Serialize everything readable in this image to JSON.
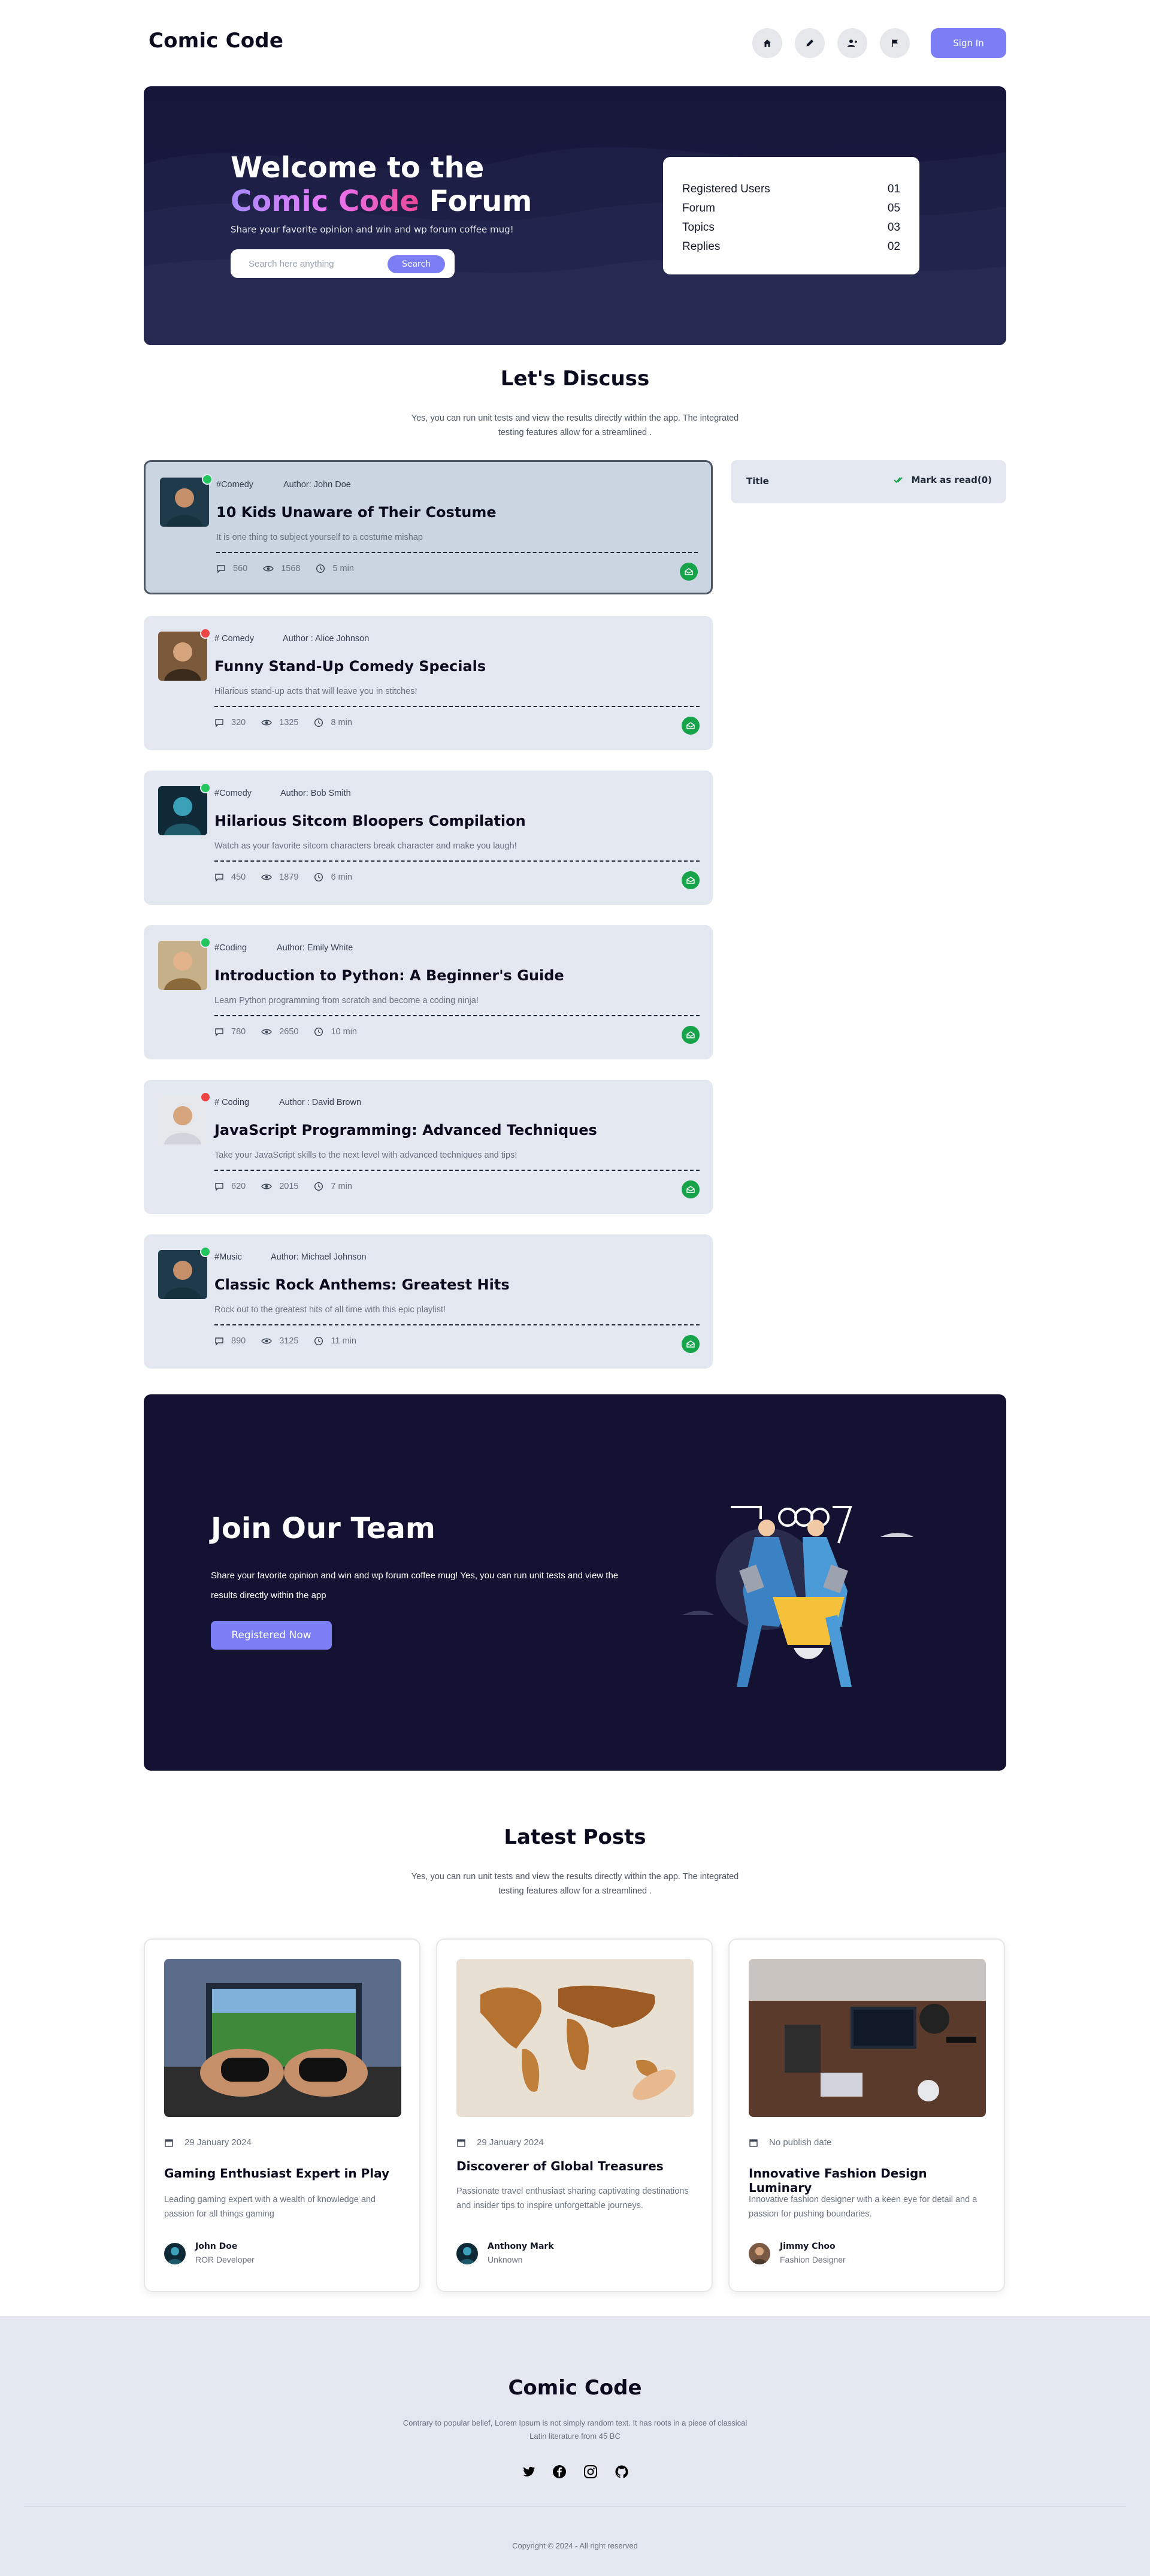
{
  "header": {
    "logo": "Comic Code",
    "icons": [
      "home-icon",
      "pencil-icon",
      "add-user-icon",
      "flag-icon"
    ],
    "signin_label": "Sign In"
  },
  "hero": {
    "title_line1": "Welcome to the",
    "title_highlight": "Comic Code",
    "title_rest": " Forum",
    "subtitle": "Share your favorite opinion and win and wp forum coffee mug!",
    "search_placeholder": "Search here anything",
    "search_button": "Search",
    "stats": [
      {
        "label": "Registered Users",
        "value": "01"
      },
      {
        "label": "Forum",
        "value": "05"
      },
      {
        "label": "Topics",
        "value": "03"
      },
      {
        "label": "Replies",
        "value": "02"
      }
    ]
  },
  "discuss": {
    "title": "Let's Discuss",
    "description": "Yes, you can run unit tests and view the results directly within the app. The integrated testing features allow for a streamlined .",
    "side_title": "Title",
    "mark_read": "Mark as read(0)",
    "topics": [
      {
        "tag": "#Comedy",
        "author": "Author: John Doe",
        "title": "10 Kids Unaware of Their Costume",
        "desc": "It is one thing to subject yourself to a costume mishap",
        "comments": "560",
        "views": "1568",
        "time": "5 min",
        "status_color": "#22c55e"
      },
      {
        "tag": "# Comedy",
        "author": "Author : Alice Johnson",
        "title": "Funny Stand-Up Comedy Specials",
        "desc": "Hilarious stand-up acts that will leave you in stitches!",
        "comments": "320",
        "views": "1325",
        "time": "8 min",
        "status_color": "#ef4444"
      },
      {
        "tag": "#Comedy",
        "author": "Author: Bob Smith",
        "title": "Hilarious Sitcom Bloopers Compilation",
        "desc": "Watch as your favorite sitcom characters break character and make you laugh!",
        "comments": "450",
        "views": "1879",
        "time": "6 min",
        "status_color": "#22c55e"
      },
      {
        "tag": "#Coding",
        "author": "Author: Emily White",
        "title": "Introduction to Python: A Beginner's Guide",
        "desc": "Learn Python programming from scratch and become a coding ninja!",
        "comments": "780",
        "views": "2650",
        "time": "10 min",
        "status_color": "#22c55e"
      },
      {
        "tag": "# Coding",
        "author": "Author : David Brown",
        "title": "JavaScript Programming: Advanced Techniques",
        "desc": "Take your JavaScript skills to the next level with advanced techniques and tips!",
        "comments": "620",
        "views": "2015",
        "time": "7 min",
        "status_color": "#ef4444"
      },
      {
        "tag": "#Music",
        "author": "Author: Michael Johnson",
        "title": "Classic Rock Anthems: Greatest Hits",
        "desc": "Rock out to the greatest hits of all time with this epic playlist!",
        "comments": "890",
        "views": "3125",
        "time": "11 min",
        "status_color": "#22c55e"
      }
    ]
  },
  "join": {
    "title": "Join Our Team",
    "description": "Share your favorite opinion and win and wp forum coffee mug! Yes, you can run unit tests and view the results directly within the app",
    "button": "Registered Now"
  },
  "latest": {
    "title": "Latest Posts",
    "description": "Yes, you can run unit tests and view the results directly within the app. The integrated testing features allow for a streamlined .",
    "posts": [
      {
        "date": "29 January 2024",
        "title": "Gaming Enthusiast Expert in Play",
        "desc": "Leading gaming expert with a wealth of knowledge and passion for all things gaming",
        "name": "John Doe",
        "role": "ROR Developer"
      },
      {
        "date": "29 January 2024",
        "title": "Discoverer of Global Treasures",
        "desc": "Passionate travel enthusiast sharing captivating destinations and insider tips to inspire unforgettable journeys.",
        "name": "Anthony Mark",
        "role": "Unknown"
      },
      {
        "date": "No publish date",
        "title": "Innovative Fashion Design Luminary",
        "desc": "Innovative fashion designer with a keen eye for detail and a passion for pushing boundaries.",
        "name": "Jimmy Choo",
        "role": "Fashion Designer"
      }
    ]
  },
  "footer": {
    "title": "Comic Code",
    "description": "Contrary to popular belief, Lorem Ipsum is not simply random text. It has roots in a piece of classical Latin literature from 45 BC",
    "social": [
      "twitter-icon",
      "facebook-icon",
      "instagram-icon",
      "github-icon"
    ],
    "copyright": "Copyright © 2024 - All right reserved"
  },
  "colors": {
    "accent": "#7c7ef5",
    "dark": "#131232",
    "card": "#e2e7f0",
    "success": "#16a34a"
  }
}
